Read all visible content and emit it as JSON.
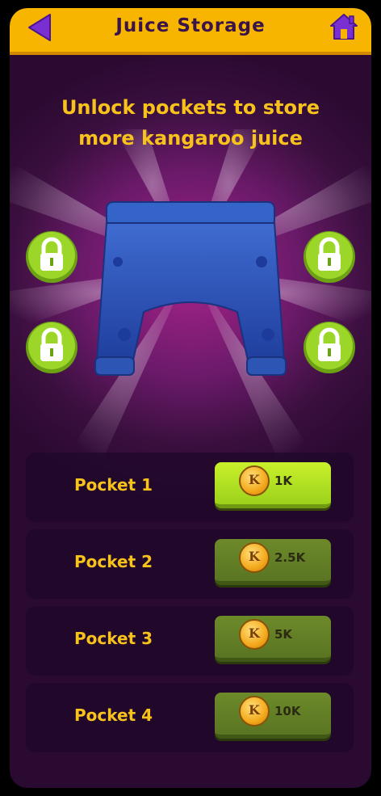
{
  "header": {
    "title": "Juice Storage",
    "back_icon": "back-triangle-icon",
    "home_icon": "home-icon"
  },
  "headline": {
    "line1": "Unlock pockets to store",
    "line2": "more kangaroo juice"
  },
  "hero": {
    "image": "blue-pants-icon"
  },
  "locks": [
    {
      "icon": "padlock-icon"
    },
    {
      "icon": "padlock-icon"
    },
    {
      "icon": "padlock-icon"
    },
    {
      "icon": "padlock-icon"
    }
  ],
  "pockets": [
    {
      "label": "Pocket 1",
      "price": "1K",
      "currency_letter": "K",
      "state": "available"
    },
    {
      "label": "Pocket 2",
      "price": "2.5K",
      "currency_letter": "K",
      "state": "locked"
    },
    {
      "label": "Pocket 3",
      "price": "5K",
      "currency_letter": "K",
      "state": "locked"
    },
    {
      "label": "Pocket 4",
      "price": "10K",
      "currency_letter": "K",
      "state": "locked"
    }
  ],
  "colors": {
    "accent": "#f7b500",
    "headline": "#f7c21b",
    "button_active": "#b3e41f",
    "button_locked": "#5f7b24",
    "lock_green": "#8fd11f"
  }
}
